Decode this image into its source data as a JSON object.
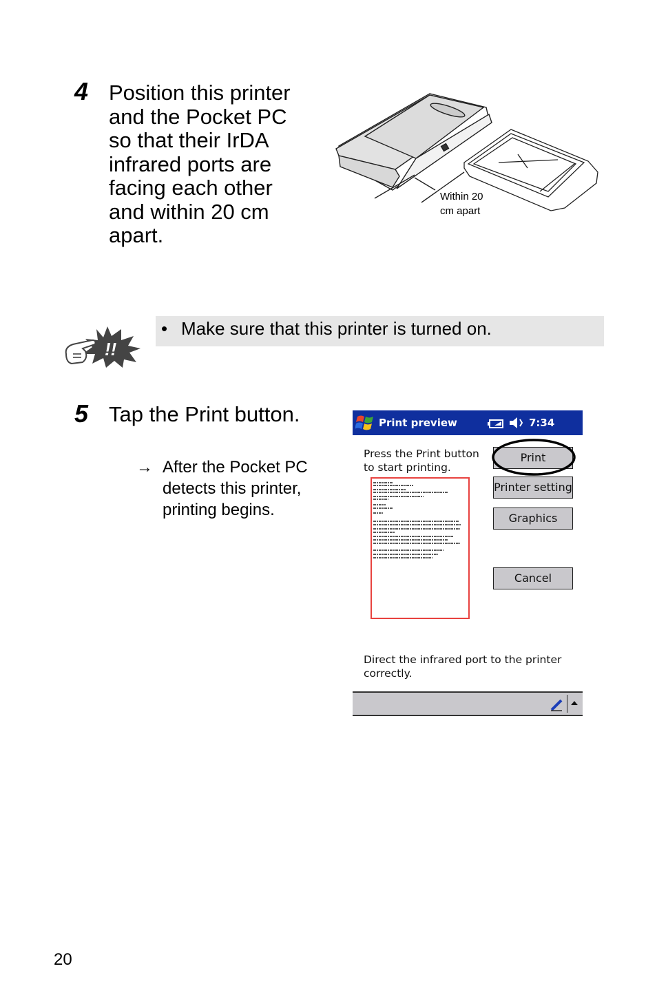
{
  "step4": {
    "number": "4",
    "text": "Position this printer\nand the Pocket PC\nso that their IrDA\ninfrared ports are\nfacing each other\nand within 20 cm\napart.",
    "illustration_label": "Within 20\ncm apart"
  },
  "note": {
    "icon": "pointing-hand-exclamation-icon",
    "bullet": "•",
    "text": "Make sure that this printer is turned on."
  },
  "step5": {
    "number": "5",
    "text": "Tap the Print button.",
    "result_arrow": "→",
    "result_text": "After the Pocket PC\ndetects this printer,\nprinting begins."
  },
  "pocketpc": {
    "title": "Print preview",
    "time": "7:34",
    "instruction": "Press the Print button\nto start printing.",
    "buttons": {
      "print": "Print",
      "printer_setting": "Printer setting",
      "graphics": "Graphics",
      "cancel": "Cancel"
    },
    "status_message": "Direct the infrared port to the printer\ncorrectly.",
    "colors": {
      "titlebar": "#0f2f9e",
      "preview_border": "#e8423f",
      "button": "#c9c8cc"
    }
  },
  "page_number": "20"
}
